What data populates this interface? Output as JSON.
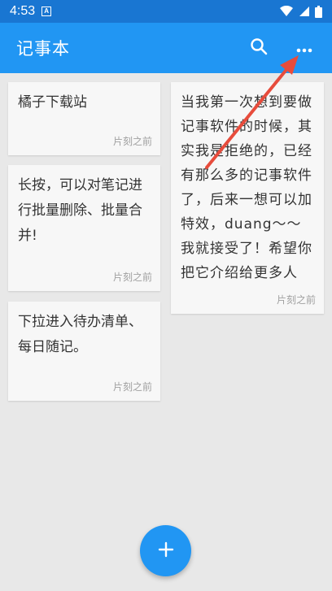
{
  "status_bar": {
    "time": "4:53",
    "notification_icon": "a-notification-icon",
    "wifi_icon": "wifi-icon",
    "signal_icon": "signal-icon",
    "battery_icon": "battery-icon"
  },
  "app_bar": {
    "title": "记事本",
    "search_icon": "search-icon",
    "more_icon": "more-vert-icon",
    "background_color": "#2196f3",
    "status_color": "#1976d2"
  },
  "notes": [
    {
      "text": "橘子下载站",
      "time": "片刻之前"
    },
    {
      "text": "长按，可以对笔记进行批量删除、批量合并!",
      "time": "片刻之前"
    },
    {
      "text": "下拉进入待办清单、每日随记。",
      "time": "片刻之前"
    },
    {
      "text": "当我第一次想到要做记事软件的时候，其实我是拒绝的，已经有那么多的记事软件了，后来一想可以加特效，duang～～我就接受了！希望你把它介绍给更多人",
      "time": "片刻之前"
    }
  ],
  "fab": {
    "icon": "plus-icon"
  },
  "annotation": {
    "arrow_icon": "red-arrow-annotation",
    "color": "#e74c3c"
  }
}
